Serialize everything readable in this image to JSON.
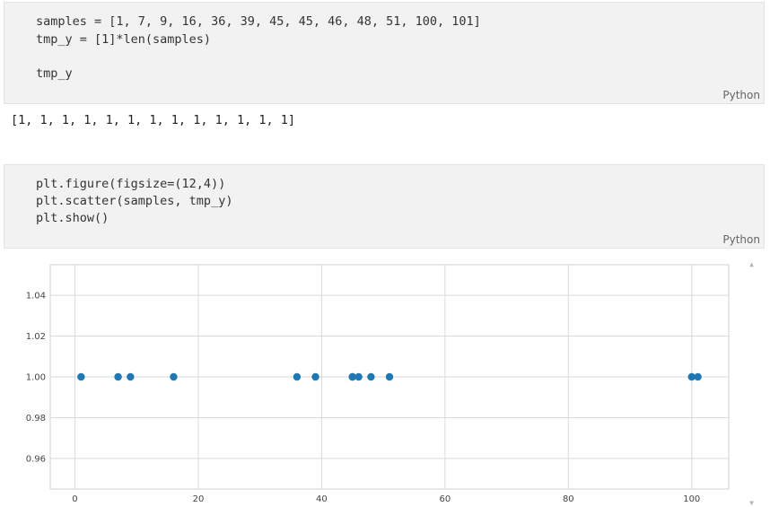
{
  "cell1": {
    "code_lines": [
      "samples = [1, 7, 9, 16, 36, 39, 45, 45, 46, 48, 51, 100, 101]",
      "tmp_y = [1]*len(samples)",
      "",
      "tmp_y"
    ],
    "language": "Python",
    "output": "[1, 1, 1, 1, 1, 1, 1, 1, 1, 1, 1, 1, 1]"
  },
  "cell2": {
    "code_lines": [
      "plt.figure(figsize=(12,4))",
      "plt.scatter(samples, tmp_y)",
      "plt.show()"
    ],
    "language": "Python"
  },
  "scroll_icons": {
    "up": "scroll-up-arrow-icon",
    "down": "scroll-down-arrow-icon"
  },
  "chart_data": {
    "type": "scatter",
    "x": [
      1,
      7,
      9,
      16,
      36,
      39,
      45,
      45,
      46,
      48,
      51,
      100,
      101
    ],
    "y": [
      1,
      1,
      1,
      1,
      1,
      1,
      1,
      1,
      1,
      1,
      1,
      1,
      1
    ],
    "xlim": [
      -4,
      106
    ],
    "ylim": [
      0.945,
      1.055
    ],
    "xticks": [
      0,
      20,
      40,
      60,
      80,
      100
    ],
    "xtick_labels": [
      "0",
      "20",
      "40",
      "60",
      "80",
      "100"
    ],
    "yticks": [
      0.96,
      0.98,
      1.0,
      1.02,
      1.04
    ],
    "ytick_labels": [
      "0.96",
      "0.98",
      "1.00",
      "1.02",
      "1.04"
    ],
    "grid": true,
    "color": "#1f77b4"
  }
}
